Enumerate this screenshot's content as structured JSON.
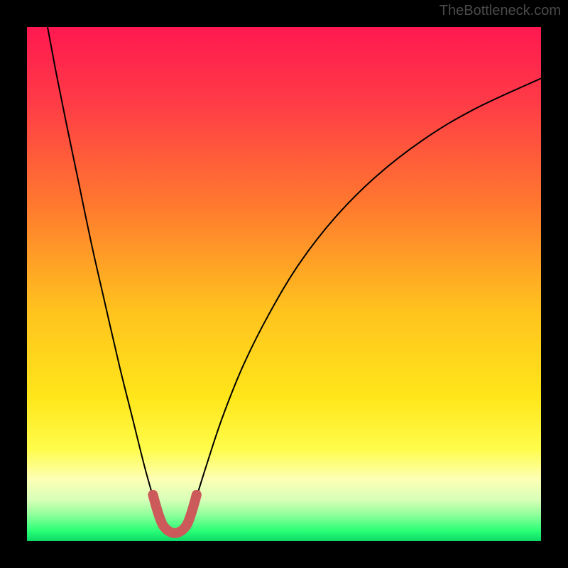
{
  "watermark": "TheBottleneck.com",
  "chart_data": {
    "type": "line",
    "title": "",
    "xlabel": "",
    "ylabel": "",
    "xlim": [
      0,
      100
    ],
    "ylim": [
      0,
      100
    ],
    "gradient_stops": [
      {
        "offset": 0,
        "color": "#ff1850"
      },
      {
        "offset": 15,
        "color": "#ff3c46"
      },
      {
        "offset": 35,
        "color": "#ff7a2e"
      },
      {
        "offset": 55,
        "color": "#ffc21e"
      },
      {
        "offset": 72,
        "color": "#ffe61a"
      },
      {
        "offset": 82,
        "color": "#fffc4a"
      },
      {
        "offset": 88,
        "color": "#fdffb5"
      },
      {
        "offset": 92,
        "color": "#d8ffb8"
      },
      {
        "offset": 95,
        "color": "#8cff9a"
      },
      {
        "offset": 98,
        "color": "#2bff76"
      },
      {
        "offset": 100,
        "color": "#0cd967"
      }
    ],
    "series": [
      {
        "name": "left-curve",
        "color": "#000000",
        "points": [
          {
            "x": 4.0,
            "y": 100.0
          },
          {
            "x": 5.5,
            "y": 92.0
          },
          {
            "x": 7.5,
            "y": 82.0
          },
          {
            "x": 10.0,
            "y": 70.0
          },
          {
            "x": 12.5,
            "y": 58.0
          },
          {
            "x": 15.0,
            "y": 47.0
          },
          {
            "x": 18.0,
            "y": 34.0
          },
          {
            "x": 20.5,
            "y": 24.0
          },
          {
            "x": 23.0,
            "y": 14.0
          },
          {
            "x": 25.0,
            "y": 7.0
          }
        ]
      },
      {
        "name": "right-curve",
        "color": "#000000",
        "points": [
          {
            "x": 32.5,
            "y": 7.0
          },
          {
            "x": 35.0,
            "y": 15.0
          },
          {
            "x": 38.0,
            "y": 24.0
          },
          {
            "x": 42.0,
            "y": 34.0
          },
          {
            "x": 47.0,
            "y": 44.0
          },
          {
            "x": 53.0,
            "y": 54.0
          },
          {
            "x": 60.0,
            "y": 63.0
          },
          {
            "x": 68.0,
            "y": 71.0
          },
          {
            "x": 77.0,
            "y": 78.0
          },
          {
            "x": 87.0,
            "y": 84.0
          },
          {
            "x": 100.0,
            "y": 90.0
          }
        ]
      },
      {
        "name": "bottom-highlight",
        "color": "#cc5a5a",
        "points": [
          {
            "x": 24.5,
            "y": 9.0
          },
          {
            "x": 25.5,
            "y": 5.5
          },
          {
            "x": 26.5,
            "y": 3.0
          },
          {
            "x": 28.0,
            "y": 1.7
          },
          {
            "x": 29.5,
            "y": 1.7
          },
          {
            "x": 31.0,
            "y": 3.0
          },
          {
            "x": 32.0,
            "y": 5.5
          },
          {
            "x": 33.0,
            "y": 9.0
          }
        ]
      }
    ]
  }
}
